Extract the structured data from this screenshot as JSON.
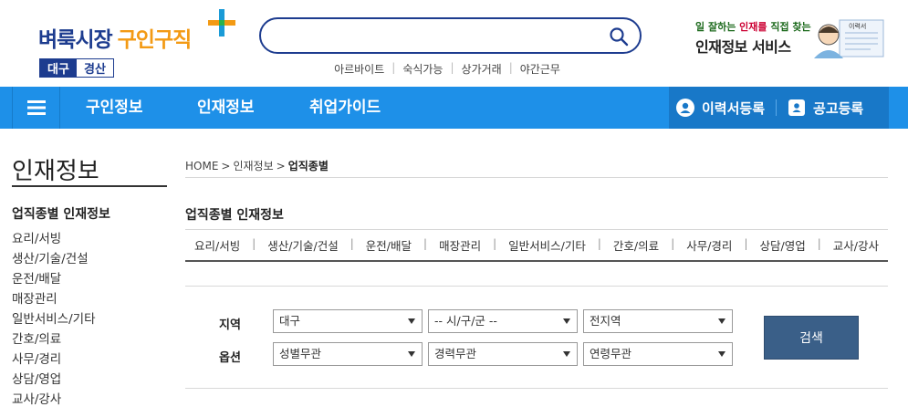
{
  "header": {
    "logo_part1": "벼룩시장",
    "logo_part2": "구인구직",
    "region_1": "대구",
    "region_2": "경산",
    "search_placeholder": "",
    "quick_links": [
      "아르바이트",
      "숙식가능",
      "상가거래",
      "야간근무"
    ],
    "banner_line1_pre": "일 잘하는 ",
    "banner_line1_em": "인재를",
    "banner_line1_post": " 직접 찾는",
    "banner_line2": "인재정보 서비스",
    "banner_doc_label": "이력서"
  },
  "nav": {
    "items": [
      "구인정보",
      "인재정보",
      "취업가이드"
    ],
    "resume_register": "이력서등록",
    "post_register": "공고등록"
  },
  "sidebar": {
    "title": "인재정보",
    "subtitle": "업직종별 인재정보",
    "items": [
      "요리/서빙",
      "생산/기술/건설",
      "운전/배달",
      "매장관리",
      "일반서비스/기타",
      "간호/의료",
      "사무/경리",
      "상담/영업",
      "교사/강사"
    ]
  },
  "main": {
    "breadcrumb": [
      "HOME",
      "인재정보",
      "업직종별"
    ],
    "title": "업직종별 인재정보",
    "categories": [
      "요리/서빙",
      "생산/기술/건설",
      "운전/배달",
      "매장관리",
      "일반서비스/기타",
      "간호/의료",
      "사무/경리",
      "상담/영업",
      "교사/강사"
    ],
    "filter": {
      "region_label": "지역",
      "option_label": "옵션",
      "region_select": "대구",
      "city_select": "-- 시/구/군 --",
      "area_select": "전지역",
      "gender_select": "성별무관",
      "career_select": "경력무관",
      "age_select": "연령무관",
      "search_button": "검색"
    }
  },
  "colors": {
    "brand_navy": "#1d3c8f",
    "brand_orange": "#f39a14",
    "nav_blue": "#1e90e8",
    "search_button": "#3a5f88"
  }
}
